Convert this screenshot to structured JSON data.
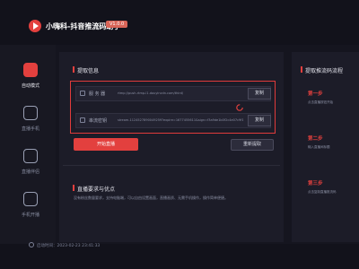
{
  "app": {
    "title": "小嗨科-抖音推流码助手",
    "version_badge": "V1.0.0"
  },
  "sidebar": {
    "items": [
      {
        "label": "自动模式",
        "icon": "auto-mode-icon",
        "active": true
      },
      {
        "label": "直播手机",
        "icon": "camera-icon",
        "active": false
      },
      {
        "label": "直播伴侣",
        "icon": "live-companion-icon",
        "active": false
      },
      {
        "label": "手机开播",
        "icon": "phone-icon",
        "active": false
      }
    ]
  },
  "main": {
    "fetch_section_title": "提取信息",
    "server": {
      "label": "服 务 器",
      "value": "rtmp://push-rtmp-l1.douyincdn.com/third/"
    },
    "stream_key": {
      "label": "串流密钥",
      "value": "stream-1124527890049259?expire=1677455611&sign=f3a9de1b0f2c4e07c9f1"
    },
    "copy_label": "复制",
    "start_button": "开始直播",
    "refetch_button": "重新提取",
    "requirements_title": "直播要求与优点",
    "requirements_desc": "没有粉丝数量要求，支持电脑端，可以自由设置画面，直播画质、无需手机操作，操作简单便捷。"
  },
  "right_panel": {
    "title": "提取推流码流程",
    "steps": [
      {
        "label": "第一步",
        "desc": "点击直播按钮开始"
      },
      {
        "label": "第二步",
        "desc": "输入直播间标题"
      },
      {
        "label": "第三步",
        "desc": "点击复制直播推流码"
      }
    ]
  },
  "status_bar": {
    "text": "启动时间：2023-02-23 23:41:33"
  },
  "colors": {
    "accent": "#e3403e",
    "background": "#15151f",
    "panel": "#1c1c28"
  }
}
